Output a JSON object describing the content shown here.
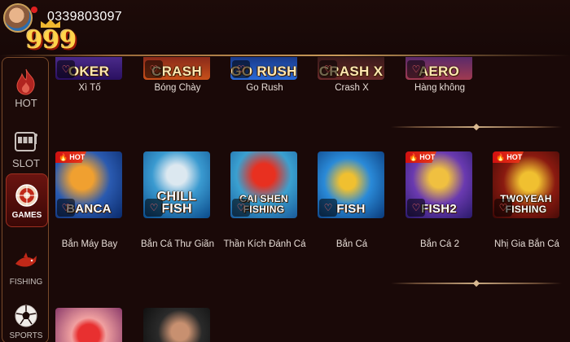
{
  "header": {
    "phone": "0339803097",
    "logo_text": "999"
  },
  "sidebar": {
    "items": [
      {
        "label": "HOT",
        "icon": "flame-icon"
      },
      {
        "label": "SLOT",
        "icon": "slot-machine-icon"
      },
      {
        "label": "GAMES",
        "icon": "roulette-icon",
        "active": true
      },
      {
        "label": "FISHING",
        "icon": "shark-icon"
      },
      {
        "label": "SPORTS",
        "icon": "soccer-ball-icon"
      }
    ]
  },
  "row1": [
    {
      "art": "OKER",
      "label": "Xì Tố"
    },
    {
      "art": "CRASH",
      "label": "Bóng Chày"
    },
    {
      "art": "GO RUSH",
      "label": "Go Rush"
    },
    {
      "art": "CRASH X",
      "label": "Crash X"
    },
    {
      "art": "AERO",
      "label": "Hàng không"
    }
  ],
  "row2": [
    {
      "art": "BANCA",
      "label": "Bắn Máy Bay",
      "hot": "HOT"
    },
    {
      "art": "CHILL FISH",
      "label": "Bắn Cá Thư Giãn"
    },
    {
      "art": "CAI SHEN FISHING",
      "label": "Thần Kích Đánh Cá"
    },
    {
      "art": "FISH",
      "label": "Bắn Cá"
    },
    {
      "art": "FISH2",
      "label": "Bắn Cá 2",
      "hot": "HOT"
    },
    {
      "art": "TWOYEAH FISHING",
      "label": "Nhị Gia Bắn Cá",
      "hot": "HOT"
    }
  ],
  "colors": {
    "background": "#1a0908",
    "accent_gold": "#c89a5a",
    "hot_red": "#d01010"
  }
}
